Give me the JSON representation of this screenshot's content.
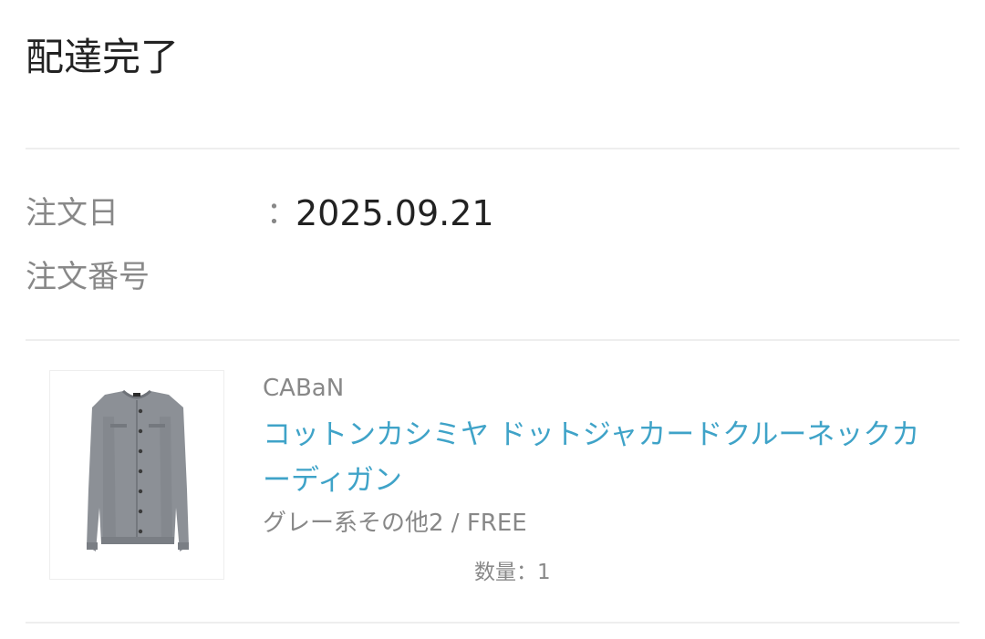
{
  "status": {
    "title": "配達完了"
  },
  "order_info": {
    "date_label": "注文日",
    "colon": "：",
    "date_value": "2025.09.21",
    "number_label": "注文番号"
  },
  "product": {
    "brand": "CABaN",
    "name": "コットンカシミヤ ドットジャカードクルーネックカーディガン",
    "variant": "グレー系その他2 / FREE",
    "quantity": "数量：1",
    "image_icon": "cardigan-image"
  },
  "colors": {
    "link": "#3fa3c8",
    "muted": "#888888",
    "divider": "#eeeeee"
  }
}
